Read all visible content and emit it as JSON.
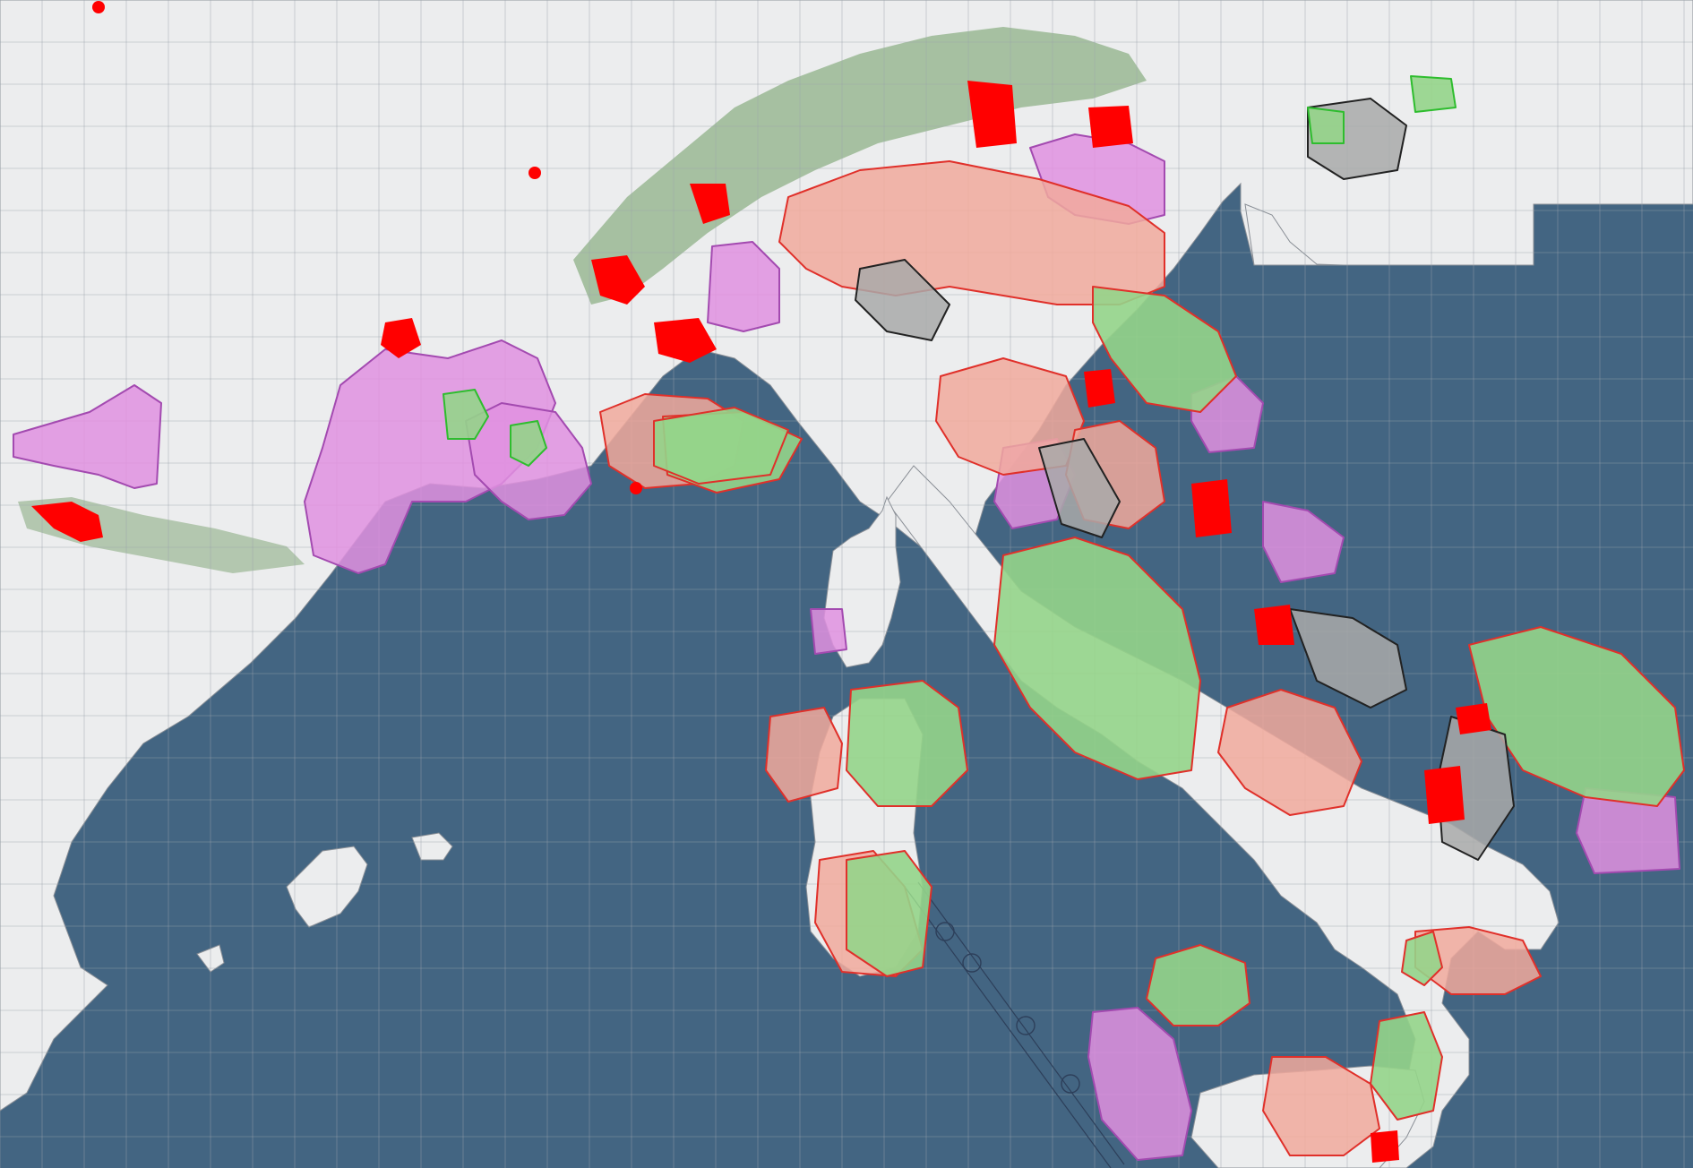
{
  "map": {
    "colors": {
      "sea": "#436582",
      "land": "#ecedee",
      "land_stroke": "#8a8f96",
      "mountain": "#6e9a62",
      "grid": "#9aa3ab",
      "restricted_fill": "#f1a99c",
      "restricted_stroke": "#e0302a",
      "danger_fill": "#e090e0",
      "danger_stroke": "#a34ab0",
      "controlled_fill": "#95d48a",
      "controlled_stroke": "#e0302a",
      "prohibited_fill": "#a9a9a9",
      "prohibited_stroke": "#222222",
      "green_zone_stroke": "#2ebd2e",
      "hot_spot": "#ff0000"
    },
    "legend_visible": false,
    "grid": "on"
  }
}
